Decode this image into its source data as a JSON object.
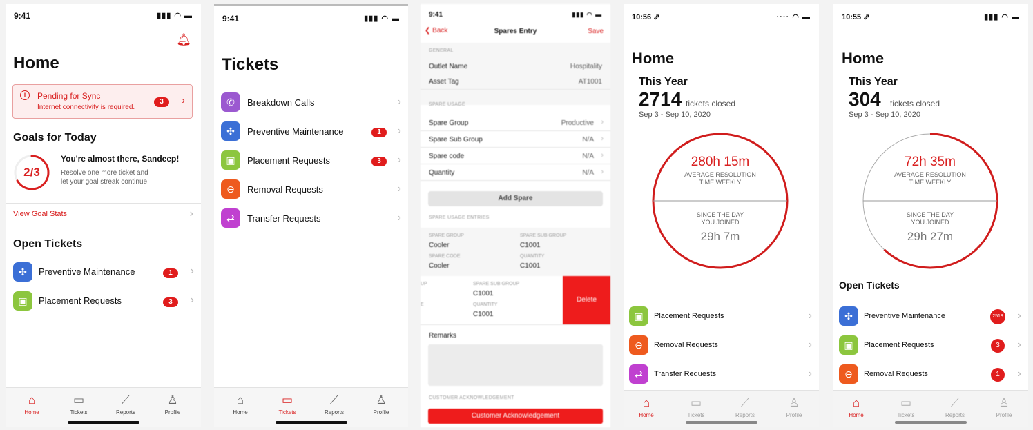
{
  "screens": [
    {
      "time": "9:41",
      "title": "Home",
      "sync": {
        "title": "Pending for Sync",
        "subtitle": "Internet connectivity is required.",
        "badge": "3"
      },
      "goals_heading": "Goals for Today",
      "goal_progress": "2/3",
      "goal_fraction": 0.667,
      "goal_title": "You're almost there, Sandeep!",
      "goal_line1": "Resolve one more ticket and",
      "goal_line2": "let your goal streak continue.",
      "view_goal_stats": "View Goal Stats",
      "open_tickets_heading": "Open Tickets",
      "tickets": [
        {
          "label": "Preventive Maintenance",
          "badge": "1",
          "icon": "fan-icon",
          "color": "#3b6fd6"
        },
        {
          "label": "Placement Requests",
          "badge": "3",
          "icon": "box-icon",
          "color": "#8cc63e"
        }
      ],
      "tabs": [
        "Home",
        "Tickets",
        "Reports",
        "Profile"
      ]
    },
    {
      "time": "9:41",
      "title": "Tickets",
      "items": [
        {
          "label": "Breakdown Calls",
          "badge": "",
          "icon": "phone-icon",
          "color": "#9b59d0"
        },
        {
          "label": "Preventive Maintenance",
          "badge": "1",
          "icon": "fan-icon",
          "color": "#3b6fd6"
        },
        {
          "label": "Placement Requests",
          "badge": "3",
          "icon": "box-icon",
          "color": "#8cc63e"
        },
        {
          "label": "Removal Requests",
          "badge": "",
          "icon": "minus-circle-icon",
          "color": "#ee5a1e"
        },
        {
          "label": "Transfer Requests",
          "badge": "",
          "icon": "transfer-icon",
          "color": "#c040d0"
        }
      ],
      "tabs": [
        "Home",
        "Tickets",
        "Reports",
        "Profile"
      ]
    },
    {
      "time": "9:41",
      "back": "Back",
      "title": "Spares Entry",
      "save": "Save",
      "general_label": "GENERAL",
      "outlet_name_label": "Outlet Name",
      "outlet_name_value": "Hospitality",
      "asset_tag_label": "Asset Tag",
      "asset_tag_value": "AT1001",
      "spare_usage_label": "SPARE USAGE",
      "usage_rows": [
        {
          "key": "Spare Group",
          "value": "Productive"
        },
        {
          "key": "Spare Sub Group",
          "value": "N/A"
        },
        {
          "key": "Spare code",
          "value": "N/A"
        },
        {
          "key": "Quantity",
          "value": "N/A"
        }
      ],
      "add_spare": "Add Spare",
      "entries_label": "SPARE USAGE ENTRIES",
      "entry1": {
        "g_label": "SPARE GROUP",
        "g_value": "Cooler",
        "sg_label": "SPARE SUB GROUP",
        "sg_value": "C1001",
        "c_label": "SPARE CODE",
        "c_value": "Cooler",
        "q_label": "QUANTITY",
        "q_value": "C1001"
      },
      "entry2": {
        "sg_label": "SPARE SUB GROUP",
        "sg_value": "C1001",
        "q_label": "QUANTITY",
        "q_value": "C1001",
        "left1": "UP",
        "left2": "E"
      },
      "delete": "Delete",
      "remarks": "Remarks",
      "ack_label": "CUSTOMER ACKNOWLEDGEMENT",
      "ack_button": "Customer Acknowledgement"
    },
    {
      "time": "10:56 ⇗",
      "title": "Home",
      "this_year": "This Year",
      "count": "2714",
      "count_suffix": "tickets closed",
      "range": "Sep 3 -  Sep 10, 2020",
      "avg_value": "280h 15m",
      "avg_label1": "AVERAGE RESOLUTION",
      "avg_label2": "TIME WEEKLY",
      "since_label1": "SINCE THE DAY",
      "since_label2": "YOU JOINED",
      "since_value": "29h 7m",
      "progress": 1.0,
      "items": [
        {
          "label": "Placement Requests",
          "icon": "box-icon",
          "color": "#8cc63e"
        },
        {
          "label": "Removal Requests",
          "icon": "minus-circle-icon",
          "color": "#ee5a1e"
        },
        {
          "label": "Transfer Requests",
          "icon": "transfer-icon",
          "color": "#c040d0"
        }
      ],
      "tabs": [
        "Home",
        "Tickets",
        "Reports",
        "Profile"
      ]
    },
    {
      "time": "10:55 ⇗",
      "title": "Home",
      "this_year": "This Year",
      "count": "304",
      "count_suffix": "tickets closed",
      "range": "Sep 3 -  Sep 10, 2020",
      "avg_value": "72h 35m",
      "avg_label1": "AVERAGE RESOLUTION",
      "avg_label2": "TIME WEEKLY",
      "since_label1": "SINCE THE DAY",
      "since_label2": "YOU JOINED",
      "since_value": "29h 27m",
      "progress": 0.62,
      "open_tickets_heading": "Open Tickets",
      "items": [
        {
          "label": "Preventive Maintenance",
          "badge": "2518",
          "icon": "fan-icon",
          "color": "#3b6fd6"
        },
        {
          "label": "Placement Requests",
          "badge": "3",
          "icon": "box-icon",
          "color": "#8cc63e"
        },
        {
          "label": "Removal Requests",
          "badge": "1",
          "icon": "minus-circle-icon",
          "color": "#ee5a1e"
        }
      ],
      "tabs": [
        "Home",
        "Tickets",
        "Reports",
        "Profile"
      ]
    }
  ],
  "colors": {
    "accent": "#d92020",
    "sync_bg": "#fdeeee"
  }
}
